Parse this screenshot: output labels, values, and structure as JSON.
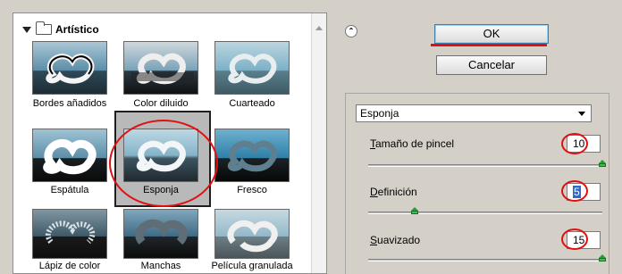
{
  "gallery": {
    "category": "Artístico",
    "filters": [
      {
        "label": "Bordes añadidos"
      },
      {
        "label": "Color diluido"
      },
      {
        "label": "Cuarteado"
      },
      {
        "label": "Espátula"
      },
      {
        "label": "Esponja"
      },
      {
        "label": "Fresco"
      },
      {
        "label": "Lápiz de color"
      },
      {
        "label": "Manchas"
      },
      {
        "label": "Película granulada"
      }
    ],
    "selected": "Esponja"
  },
  "actions": {
    "ok_label": "OK",
    "cancel_label": "Cancelar"
  },
  "settings": {
    "filter_select": "Esponja",
    "params": [
      {
        "label_first": "T",
        "label_rest": "amaño de pincel",
        "value": "10",
        "level": 10,
        "max": 10
      },
      {
        "label_first": "D",
        "label_rest": "efinición",
        "value": "5",
        "level": 5,
        "max": 25
      },
      {
        "label_first": "S",
        "label_rest": "uavizado",
        "value": "15",
        "level": 15,
        "max": 15
      }
    ]
  },
  "colors": {
    "annotation": "#e01010",
    "slider_knob": "#3fbf4f"
  }
}
